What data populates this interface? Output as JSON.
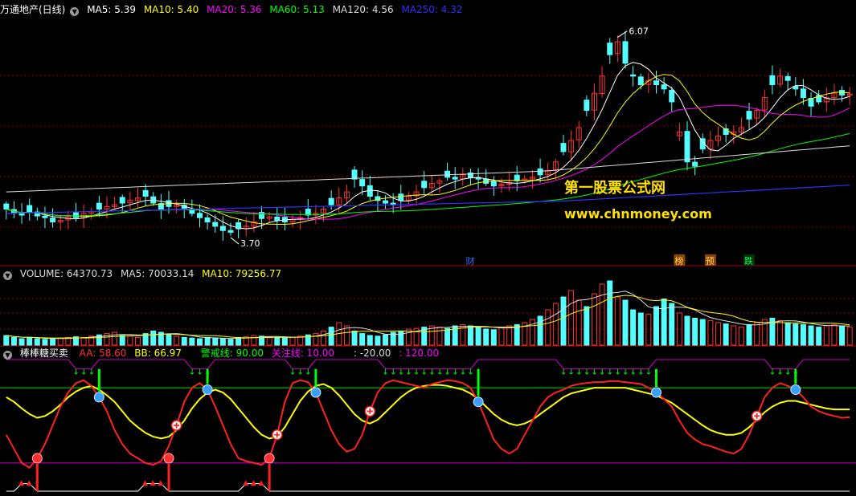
{
  "panels": {
    "price": {
      "title": "万通地产(日线)",
      "items": [
        {
          "label": "MA5: 5.39",
          "color": "#ffffff"
        },
        {
          "label": "MA10: 5.40",
          "color": "#ffff00"
        },
        {
          "label": "MA20: 5.36",
          "color": "#ff00ff"
        },
        {
          "label": "MA60: 5.13",
          "color": "#00ff00"
        },
        {
          "label": "MA120: 4.56",
          "color": "#dddddd"
        },
        {
          "label": "MA250: 4.32",
          "color": "#3030ff"
        }
      ]
    },
    "volume": {
      "items": [
        {
          "label": "VOLUME: 64370.73",
          "color": "#dddddd"
        },
        {
          "label": "MA5: 70033.14",
          "color": "#dddddd"
        },
        {
          "label": "MA10: 79256.77",
          "color": "#ffff00"
        }
      ]
    },
    "indicator": {
      "title": "棒棒糖买卖",
      "items": [
        {
          "label": "AA: 58.60",
          "color": "#ff3030"
        },
        {
          "label": "BB: 66.97",
          "color": "#ffff00"
        },
        {
          "label": "警戒线: 90.00",
          "color": "#00ff00"
        },
        {
          "label": "关注线: 10.00",
          "color": "#ff00ff"
        },
        {
          "label": ": -20.00",
          "color": "#dddddd"
        },
        {
          "label": ": 120.00",
          "color": "#ff00ff"
        }
      ]
    }
  },
  "annotations": {
    "high": "6.07",
    "low": "3.70",
    "event_cai": "财",
    "event_bang": "榜",
    "event_yu": "预",
    "event_die": "跌"
  },
  "watermark": {
    "line1": "第一股票公式网",
    "line2": "www.chnmoney.com"
  },
  "colors": {
    "up": "#ff3232",
    "down": "#54ffff",
    "grid": "#8b0000",
    "background": "#000000"
  },
  "chart_data": [
    {
      "type": "candlestick",
      "name": "price",
      "x_count": 120,
      "ylim": [
        3.4,
        6.3
      ],
      "close_series": [
        4.05,
        4.0,
        3.98,
        4.02,
        3.97,
        3.95,
        3.9,
        3.92,
        3.96,
        3.95,
        4.0,
        4.02,
        4.05,
        4.08,
        4.1,
        4.12,
        4.15,
        4.18,
        4.2,
        4.12,
        4.05,
        4.08,
        4.1,
        4.06,
        4.0,
        3.95,
        3.9,
        3.85,
        3.8,
        3.78,
        3.82,
        3.85,
        3.9,
        3.94,
        3.96,
        3.92,
        3.9,
        3.93,
        3.95,
        3.98,
        4.0,
        4.05,
        4.1,
        4.18,
        4.25,
        4.4,
        4.32,
        4.2,
        4.15,
        4.12,
        4.1,
        4.15,
        4.2,
        4.25,
        4.3,
        4.35,
        4.38,
        4.42,
        4.4,
        4.45,
        4.42,
        4.4,
        4.35,
        4.32,
        4.34,
        4.36,
        4.38,
        4.4,
        4.42,
        4.45,
        4.5,
        4.6,
        4.72,
        4.85,
        5.0,
        5.2,
        5.4,
        5.6,
        5.85,
        6.0,
        5.75,
        5.6,
        5.5,
        5.55,
        5.5,
        5.45,
        5.3,
        4.95,
        4.6,
        4.55,
        4.75,
        4.85,
        4.9,
        4.92,
        4.95,
        5.0,
        5.1,
        5.2,
        5.35,
        5.5,
        5.6,
        5.55,
        5.45,
        5.35,
        5.25,
        5.3,
        5.35,
        5.4,
        5.38,
        5.39
      ],
      "high": 6.07,
      "low": 3.7,
      "ma_lines": [
        "MA5",
        "MA10",
        "MA20",
        "MA60",
        "MA120",
        "MA250"
      ]
    },
    {
      "type": "bar",
      "name": "volume",
      "values_relative": [
        0.15,
        0.12,
        0.1,
        0.12,
        0.1,
        0.09,
        0.1,
        0.11,
        0.12,
        0.13,
        0.12,
        0.14,
        0.16,
        0.18,
        0.2,
        0.15,
        0.14,
        0.12,
        0.18,
        0.22,
        0.2,
        0.16,
        0.14,
        0.12,
        0.11,
        0.1,
        0.12,
        0.11,
        0.1,
        0.09,
        0.12,
        0.13,
        0.15,
        0.14,
        0.13,
        0.12,
        0.11,
        0.12,
        0.14,
        0.16,
        0.18,
        0.22,
        0.28,
        0.35,
        0.3,
        0.22,
        0.18,
        0.15,
        0.14,
        0.16,
        0.2,
        0.22,
        0.25,
        0.26,
        0.28,
        0.3,
        0.28,
        0.26,
        0.3,
        0.32,
        0.3,
        0.28,
        0.25,
        0.24,
        0.27,
        0.3,
        0.32,
        0.35,
        0.4,
        0.45,
        0.55,
        0.65,
        0.75,
        0.85,
        0.7,
        0.6,
        0.8,
        0.95,
        1.0,
        0.75,
        0.7,
        0.55,
        0.5,
        0.48,
        0.6,
        0.72,
        0.65,
        0.5,
        0.45,
        0.42,
        0.4,
        0.38,
        0.35,
        0.33,
        0.3,
        0.28,
        0.32,
        0.35,
        0.4,
        0.42,
        0.38,
        0.35,
        0.33,
        0.32,
        0.3,
        0.28,
        0.3,
        0.32,
        0.3,
        0.28
      ]
    },
    {
      "type": "line",
      "name": "indicator",
      "ylim": [
        -20,
        120
      ],
      "series": [
        {
          "name": "AA",
          "values": [
            40,
            25,
            10,
            5,
            15,
            30,
            50,
            70,
            85,
            95,
            98,
            92,
            80,
            65,
            45,
            30,
            20,
            15,
            10,
            8,
            12,
            28,
            50,
            75,
            90,
            95,
            88,
            70,
            50,
            30,
            15,
            12,
            10,
            8,
            15,
            40,
            75,
            95,
            98,
            96,
            85,
            65,
            45,
            30,
            22,
            25,
            40,
            65,
            85,
            95,
            98,
            96,
            94,
            92,
            90,
            94,
            96,
            98,
            97,
            95,
            90,
            75,
            55,
            35,
            25,
            20,
            25,
            40,
            55,
            70,
            80,
            85,
            88,
            92,
            94,
            95,
            96,
            96,
            97,
            97,
            96,
            95,
            94,
            90,
            85,
            78,
            70,
            55,
            42,
            35,
            30,
            28,
            25,
            22,
            20,
            25,
            40,
            60,
            80,
            90,
            95,
            92,
            88,
            80,
            70,
            65,
            62,
            60,
            58,
            58.6
          ]
        },
        {
          "name": "BB",
          "values": [
            80,
            75,
            68,
            62,
            58,
            60,
            65,
            72,
            80,
            86,
            90,
            92,
            88,
            82,
            75,
            65,
            55,
            48,
            42,
            38,
            36,
            38,
            45,
            55,
            68,
            78,
            85,
            88,
            85,
            78,
            68,
            58,
            48,
            40,
            36,
            38,
            48,
            62,
            76,
            86,
            92,
            94,
            90,
            82,
            72,
            62,
            55,
            52,
            56,
            64,
            72,
            80,
            86,
            90,
            92,
            93,
            93,
            92,
            90,
            88,
            84,
            78,
            70,
            62,
            56,
            52,
            50,
            52,
            56,
            62,
            68,
            74,
            80,
            84,
            86,
            88,
            90,
            90,
            90,
            90,
            90,
            88,
            86,
            84,
            82,
            78,
            74,
            68,
            62,
            56,
            50,
            45,
            42,
            40,
            40,
            42,
            48,
            56,
            64,
            70,
            74,
            76,
            76,
            74,
            72,
            70,
            68,
            67,
            67,
            66.97
          ]
        }
      ],
      "levels": {
        "警戒线": 90,
        "关注线": 10
      }
    }
  ]
}
